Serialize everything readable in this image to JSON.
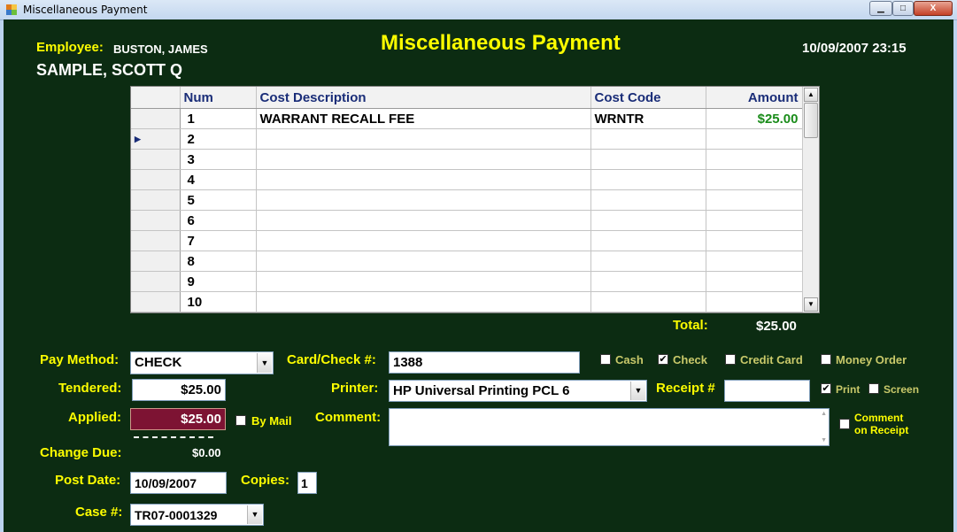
{
  "window": {
    "title": "Miscellaneous Payment",
    "min_label": "▁",
    "max_label": "□",
    "close_label": "X"
  },
  "header": {
    "title": "Miscellaneous Payment",
    "employee_label": "Employee:",
    "employee_name": "BUSTON, JAMES",
    "datetime": "10/09/2007 23:15",
    "customer_name": "SAMPLE, SCOTT Q"
  },
  "grid": {
    "columns": [
      "Num",
      "Cost Description",
      "Cost Code",
      "Amount"
    ],
    "rows": [
      [
        "1",
        "WARRANT RECALL FEE",
        "WRNTR",
        "$25.00"
      ],
      [
        "2",
        "",
        "",
        ""
      ],
      [
        "3",
        "",
        "",
        ""
      ],
      [
        "4",
        "",
        "",
        ""
      ],
      [
        "5",
        "",
        "",
        ""
      ],
      [
        "6",
        "",
        "",
        ""
      ],
      [
        "7",
        "",
        "",
        ""
      ],
      [
        "8",
        "",
        "",
        ""
      ],
      [
        "9",
        "",
        "",
        ""
      ],
      [
        "10",
        "",
        "",
        ""
      ]
    ],
    "current_row_marker": "▶"
  },
  "totals": {
    "label": "Total:",
    "value": "$25.00"
  },
  "payment": {
    "pay_method_label": "Pay Method:",
    "pay_method_value": "CHECK",
    "tendered_label": "Tendered:",
    "tendered_value": "$25.00",
    "applied_label": "Applied:",
    "applied_value": "$25.00",
    "by_mail_label": "By Mail",
    "change_due_label": "Change Due:",
    "change_due_value": "$0.00",
    "post_date_label": "Post Date:",
    "post_date_value": "10/09/2007",
    "copies_label": "Copies:",
    "copies_value": "1",
    "case_label": "Case #:",
    "case_value": "TR07-0001329",
    "card_check_label": "Card/Check #:",
    "card_check_value": "1388",
    "printer_label": "Printer:",
    "printer_value": "HP Universal Printing PCL 6",
    "comment_label": "Comment:",
    "comment_value": "",
    "receipt_label": "Receipt #",
    "receipt_value": ""
  },
  "tender_types": [
    {
      "label": "Cash",
      "checked": false
    },
    {
      "label": "Check",
      "checked": true
    },
    {
      "label": "Credit Card",
      "checked": false
    },
    {
      "label": "Money Order",
      "checked": false
    }
  ],
  "output_options": {
    "print_label": "Print",
    "print_checked": true,
    "screen_label": "Screen",
    "screen_checked": false,
    "comment_on_receipt_line1": "Comment",
    "comment_on_receipt_line2": "on Receipt",
    "comment_on_receipt_checked": false
  },
  "colors": {
    "background": "#0c2c12",
    "label_yellow": "#fdfd00",
    "option_label_olive": "#c9c96a",
    "amount_green": "#1a8c1a",
    "applied_field_bg": "#7d1333",
    "grid_header_text": "#1a2d78"
  },
  "icons": {
    "dropdown_arrow": "▼",
    "check_mark": "✔",
    "scroll_up": "▲",
    "scroll_down": "▼"
  }
}
